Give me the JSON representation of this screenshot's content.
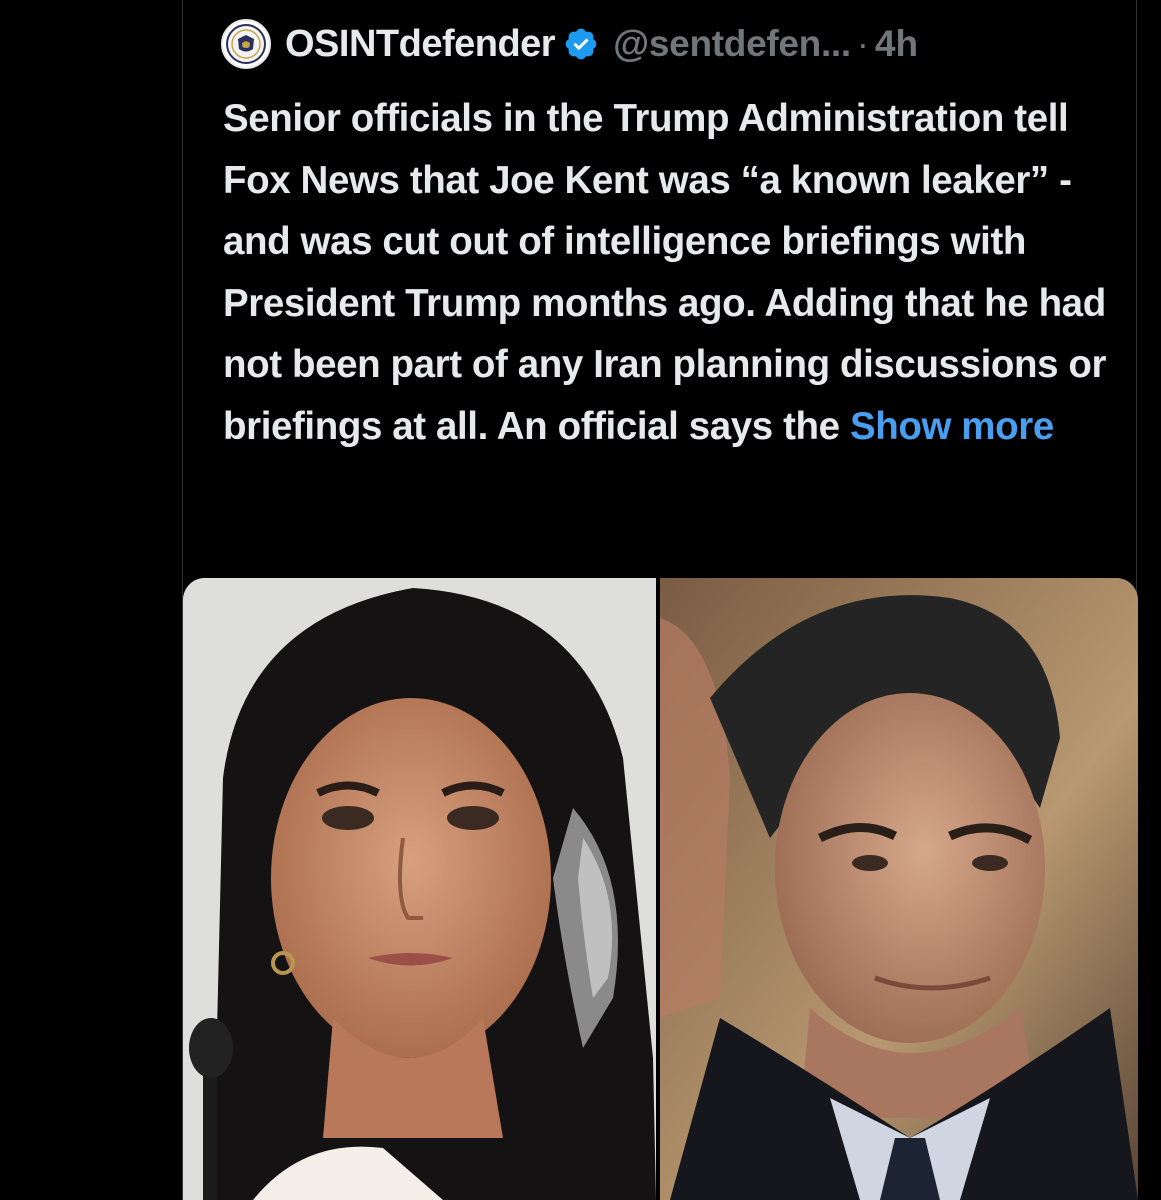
{
  "tweet": {
    "display_name": "OSINTdefender",
    "handle": "@sentdefen...",
    "separator": "·",
    "timestamp": "4h",
    "text": "Senior officials in the Trump Administration tell Fox News that Joe Kent was “a known leaker” - and was cut out of intelligence briefings with President Trump months ago. Adding that he had not been part of any Iran planning discussions or briefings at all. An official says the ",
    "show_more_label": "Show more"
  },
  "icons": {
    "avatar": "osint-seal-icon",
    "verified": "verified-badge-icon"
  },
  "colors": {
    "background": "#000000",
    "text": "#e7e9ea",
    "secondary_text": "#71767b",
    "link": "#4a9eef",
    "verified": "#1d9bf0"
  },
  "media": {
    "photos": [
      {
        "label": "woman-portrait-photo"
      },
      {
        "label": "man-portrait-photo"
      }
    ]
  }
}
